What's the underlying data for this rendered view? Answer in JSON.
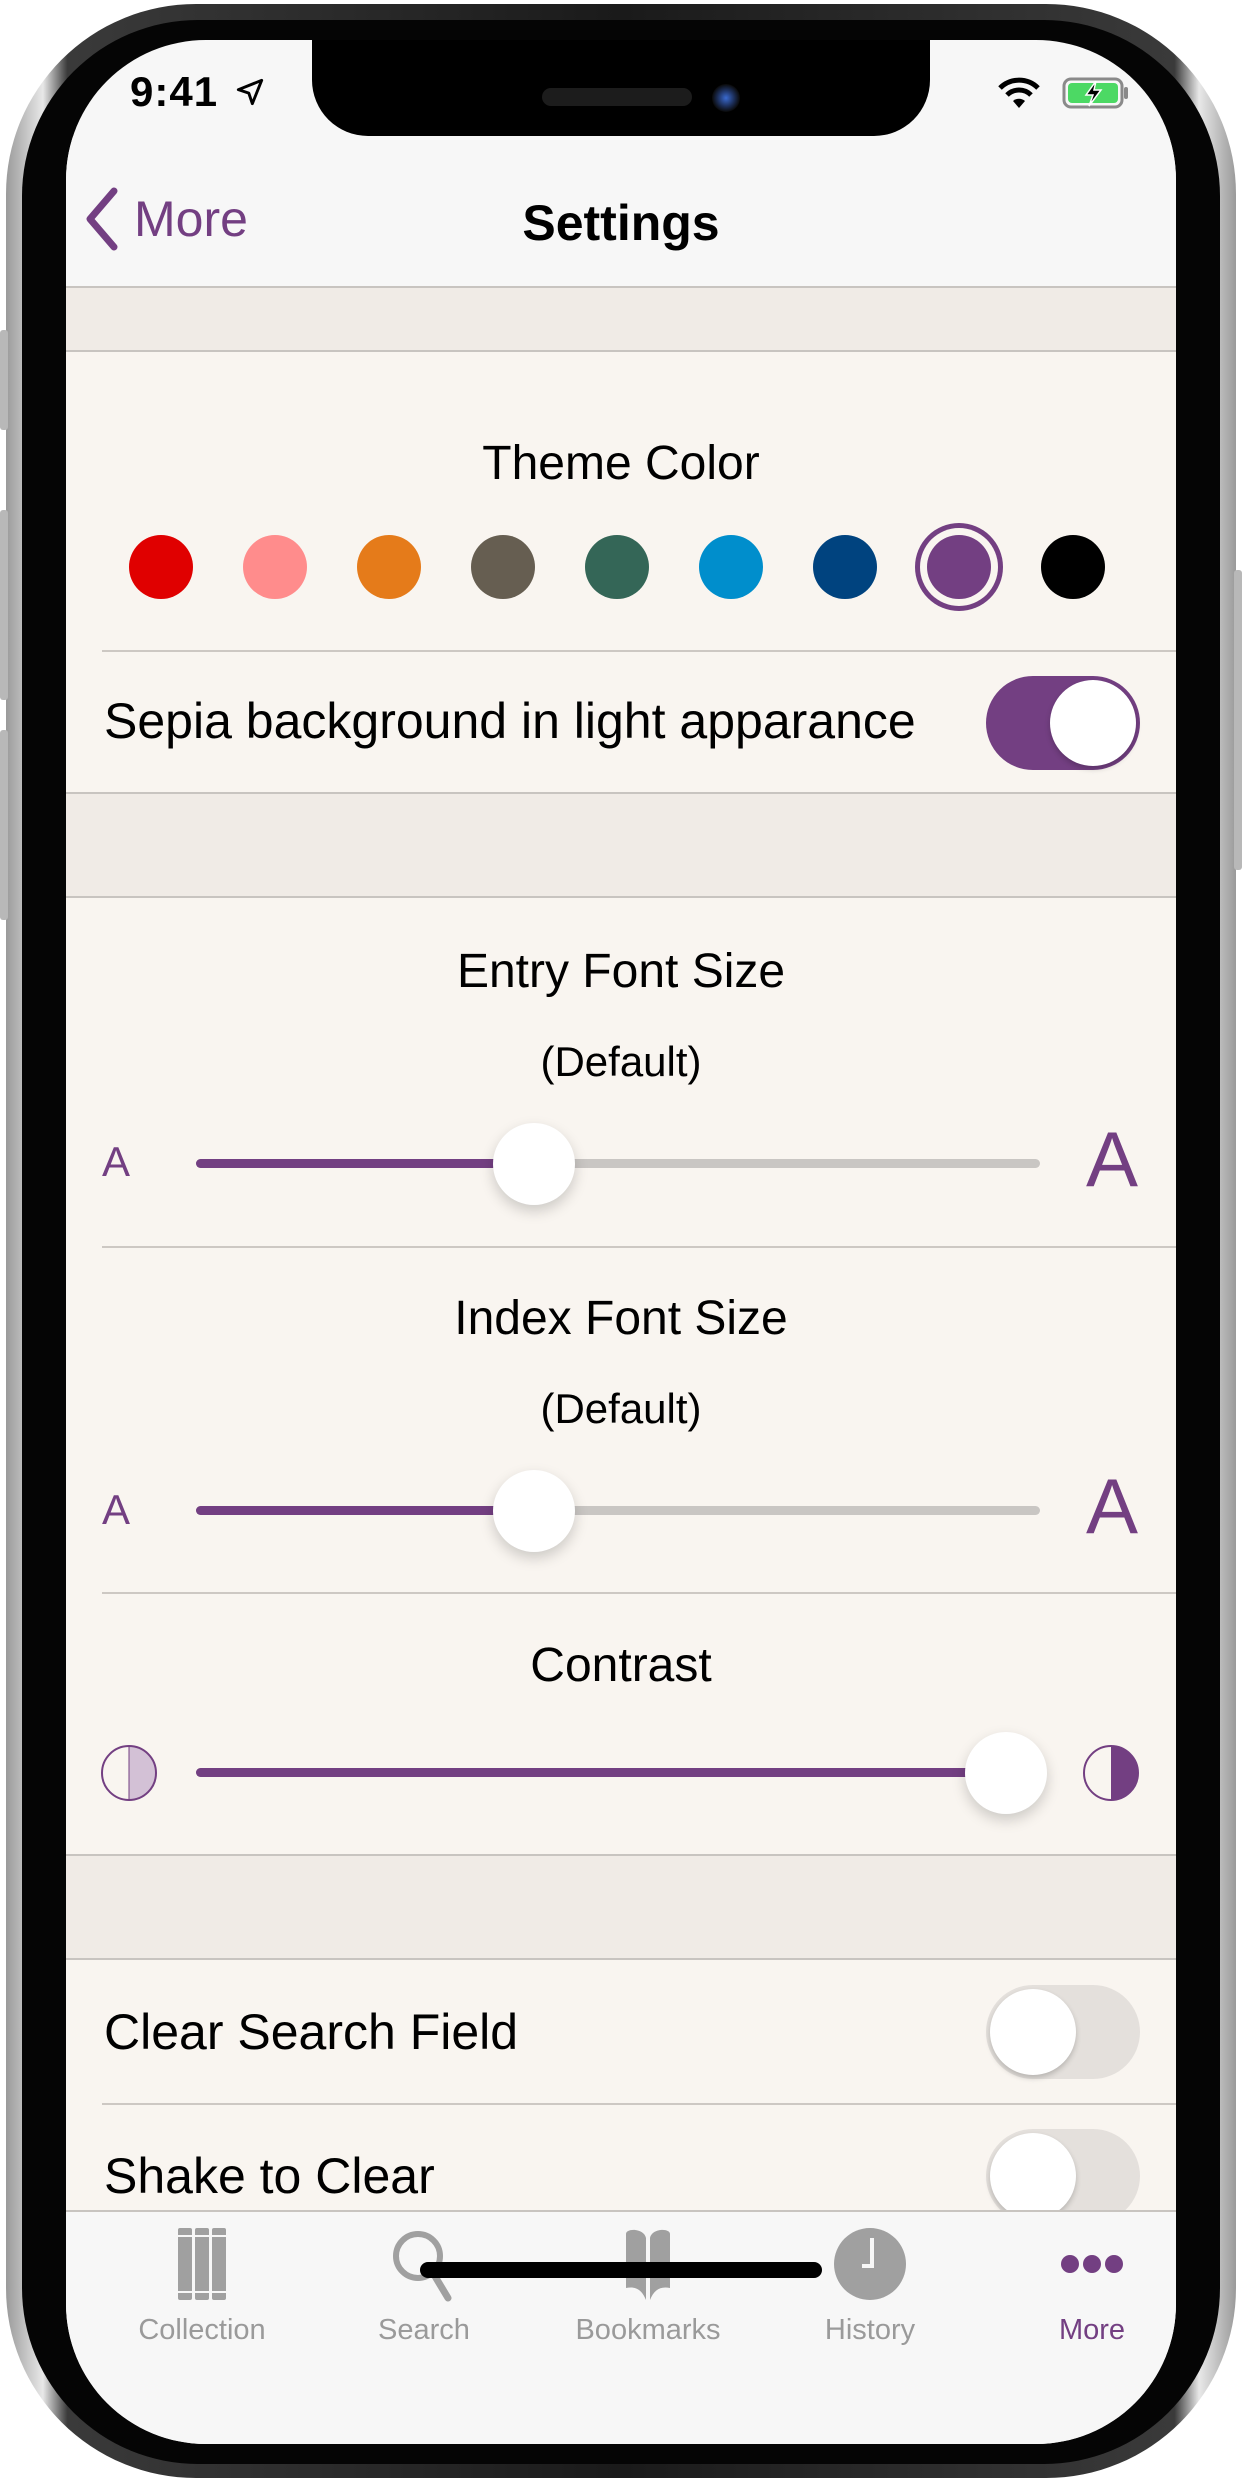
{
  "status_bar": {
    "time": "9:41",
    "icons": [
      "location-arrow-icon",
      "wifi-icon",
      "battery-charging-icon"
    ]
  },
  "nav": {
    "back_label": "More",
    "title": "Settings"
  },
  "accent_color": "#733f82",
  "theme": {
    "title": "Theme Color",
    "colors": [
      {
        "name": "red",
        "hex": "#e00000",
        "selected": false
      },
      {
        "name": "pink",
        "hex": "#ff8c8c",
        "selected": false
      },
      {
        "name": "orange",
        "hex": "#e57b1a",
        "selected": false
      },
      {
        "name": "taupe",
        "hex": "#665e51",
        "selected": false
      },
      {
        "name": "green",
        "hex": "#346657",
        "selected": false
      },
      {
        "name": "sky-blue",
        "hex": "#008ecc",
        "selected": false
      },
      {
        "name": "navy",
        "hex": "#00437f",
        "selected": false
      },
      {
        "name": "purple",
        "hex": "#733f82",
        "selected": true
      },
      {
        "name": "black",
        "hex": "#000000",
        "selected": false
      }
    ],
    "sepia_label": "Sepia background in light apparance",
    "sepia_on": true
  },
  "entry_font": {
    "title": "Entry Font Size",
    "subtitle": "(Default)",
    "small_glyph": "A",
    "large_glyph": "A",
    "value_fraction": 0.4
  },
  "index_font": {
    "title": "Index Font Size",
    "subtitle": "(Default)",
    "small_glyph": "A",
    "large_glyph": "A",
    "value_fraction": 0.4
  },
  "contrast": {
    "title": "Contrast",
    "value_fraction": 0.96
  },
  "search": {
    "clear_search_label": "Clear Search Field",
    "clear_search_on": false,
    "shake_label": "Shake to Clear",
    "shake_on": false
  },
  "tabbar": {
    "items": [
      {
        "label": "Collection",
        "icon": "books-icon",
        "active": false
      },
      {
        "label": "Search",
        "icon": "magnifier-icon",
        "active": false
      },
      {
        "label": "Bookmarks",
        "icon": "open-book-icon",
        "active": false
      },
      {
        "label": "History",
        "icon": "clock-icon",
        "active": false
      },
      {
        "label": "More",
        "icon": "ellipsis-icon",
        "active": true
      }
    ]
  }
}
